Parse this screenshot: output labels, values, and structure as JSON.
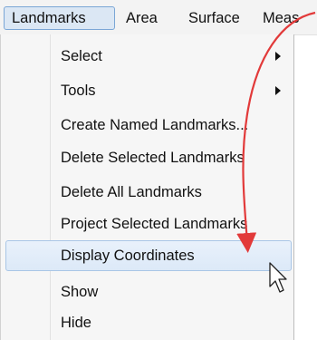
{
  "menubar": {
    "items": [
      {
        "label": "Landmarks",
        "active": true
      },
      {
        "label": "Area"
      },
      {
        "label": "Surface"
      },
      {
        "label": "Meas"
      }
    ]
  },
  "dropdown": {
    "items": [
      {
        "label": "Select",
        "submenu": true
      },
      {
        "label": "Tools",
        "submenu": true
      },
      {
        "label": "Create Named Landmarks..."
      },
      {
        "label": "Delete Selected Landmarks"
      },
      {
        "label": "Delete All Landmarks"
      },
      {
        "label": "Project Selected Landmarks"
      },
      {
        "label": "Display Coordinates",
        "highlighted": true
      },
      {
        "label": "Show"
      },
      {
        "label": "Hide"
      }
    ]
  },
  "colors": {
    "annotation_arrow": "#e23a3a",
    "highlight_border": "#a9c6e6",
    "active_menu_fill": "#dbe7f4"
  },
  "icons": {
    "annotation": "curved-arrow-icon",
    "cursor": "mouse-pointer-icon",
    "submenu": "triangle-right-icon"
  }
}
